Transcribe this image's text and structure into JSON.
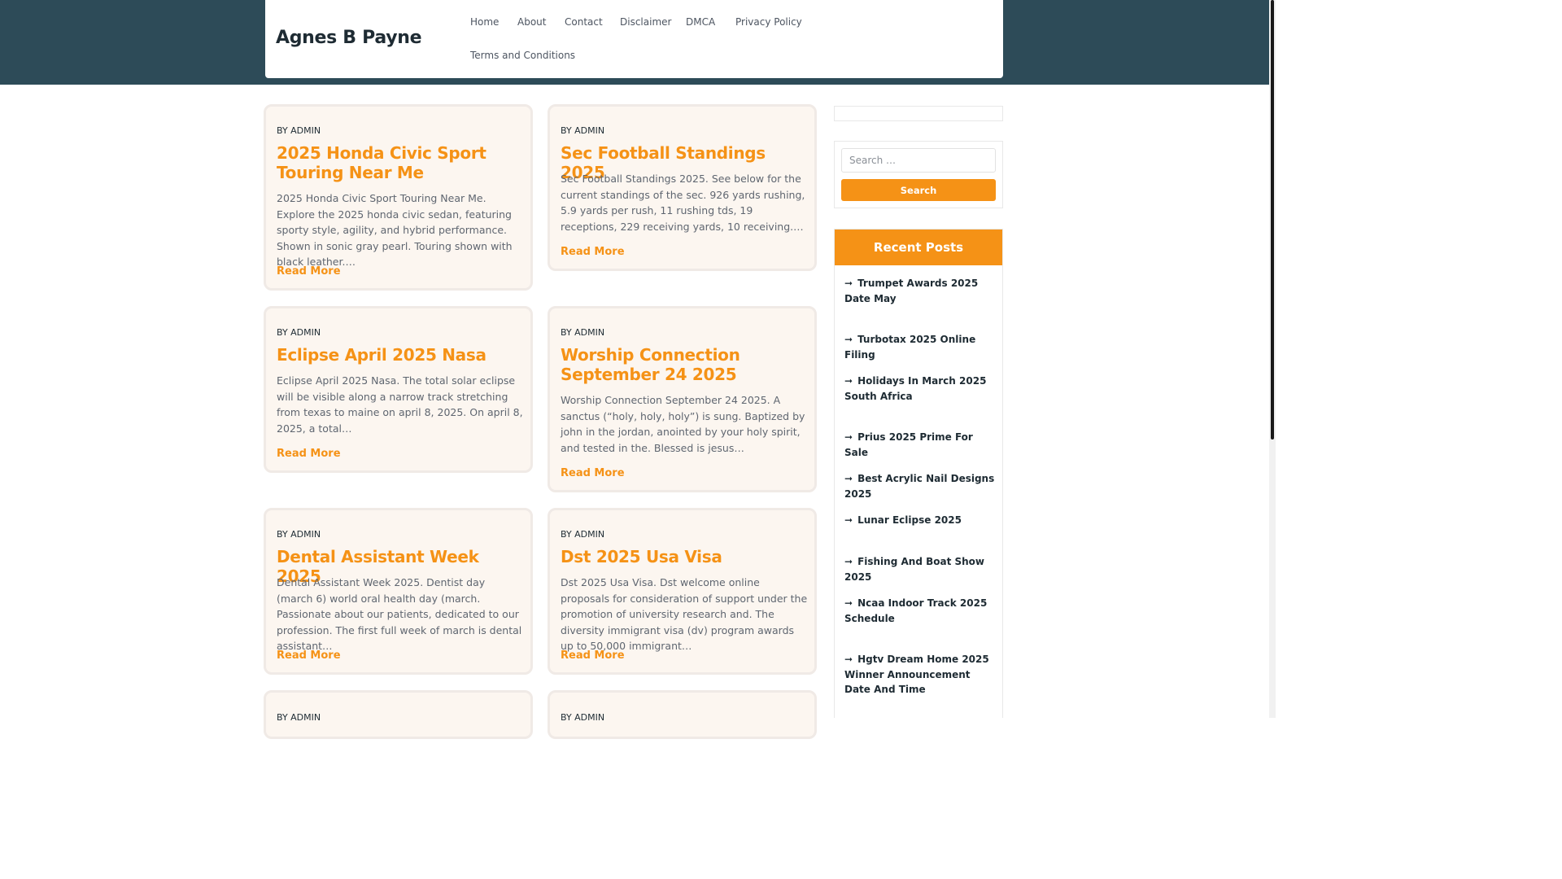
{
  "site": {
    "title": "Agnes B Payne"
  },
  "nav": [
    "Home",
    "About",
    "Contact",
    "Disclaimer",
    "DMCA",
    "Privacy Policy",
    "Terms and Conditions"
  ],
  "posts": [
    {
      "by": "BY ADMIN",
      "title": "2025 Honda Civic Sport Touring Near Me",
      "excerpt": "2025 Honda Civic Sport Touring Near Me. Explore the 2025 honda civic sedan, featuring sporty style, agility, and hybrid performance. Shown in sonic gray pearl. Touring shown with black leather.…",
      "more": "Read More"
    },
    {
      "by": "BY ADMIN",
      "title": "Sec Football Standings 2025",
      "excerpt": "Sec Football Standings 2025. See below for the current standings of the sec. 926 yards rushing, 5.9 yards per rush, 11 rushing tds, 19 receptions, 229 receiving yards, 10 receiving.…",
      "more": "Read More"
    },
    {
      "by": "BY ADMIN",
      "title": "Eclipse April 2025 Nasa",
      "excerpt": "Eclipse April 2025 Nasa. The total solar eclipse will be visible along a narrow track stretching from texas to maine on april 8, 2025. On april 8, 2025, a total…",
      "more": "Read More"
    },
    {
      "by": "BY ADMIN",
      "title": "Worship Connection September 24 2025",
      "excerpt": "Worship Connection September 24 2025. A sanctus (“holy, holy, holy”) is sung. Baptized by john in the jordan, anointed by your holy spirit, and tested in the. Blessed is jesus…",
      "more": "Read More"
    },
    {
      "by": "BY ADMIN",
      "title": "Dental Assistant Week 2025",
      "excerpt": "Dental Assistant Week 2025. Dentist day (march 6) world oral health day (march. Passionate about our patients, dedicated to our profession. The first full week of march is dental assistant…",
      "more": "Read More"
    },
    {
      "by": "BY ADMIN",
      "title": "Dst 2025 Usa Visa",
      "excerpt": "Dst 2025 Usa Visa. Dst welcome online proposals for consideration of support under the promotion of university research and. The diversity immigrant visa (dv) program awards up to 50,000 immigrant…",
      "more": "Read More"
    },
    {
      "by": "BY ADMIN"
    },
    {
      "by": "BY ADMIN"
    }
  ],
  "search": {
    "placeholder": "Search …",
    "button": "Search"
  },
  "recent": {
    "title": "Recent Posts",
    "items": [
      "Trumpet Awards 2025 Date May",
      "Turbotax 2025 Online Filing",
      "Holidays In March 2025 South Africa",
      "Prius 2025 Prime For Sale",
      "Best Acrylic Nail Designs 2025",
      "Lunar Eclipse 2025",
      "Fishing And Boat Show 2025",
      "Ncaa Indoor Track 2025 Schedule",
      "Hgtv Dream Home 2025 Winner Announcement Date And Time"
    ]
  },
  "colors": {
    "accent": "#f59216",
    "header_band": "#2d4b58",
    "card_bg": "#fcf6f0"
  }
}
